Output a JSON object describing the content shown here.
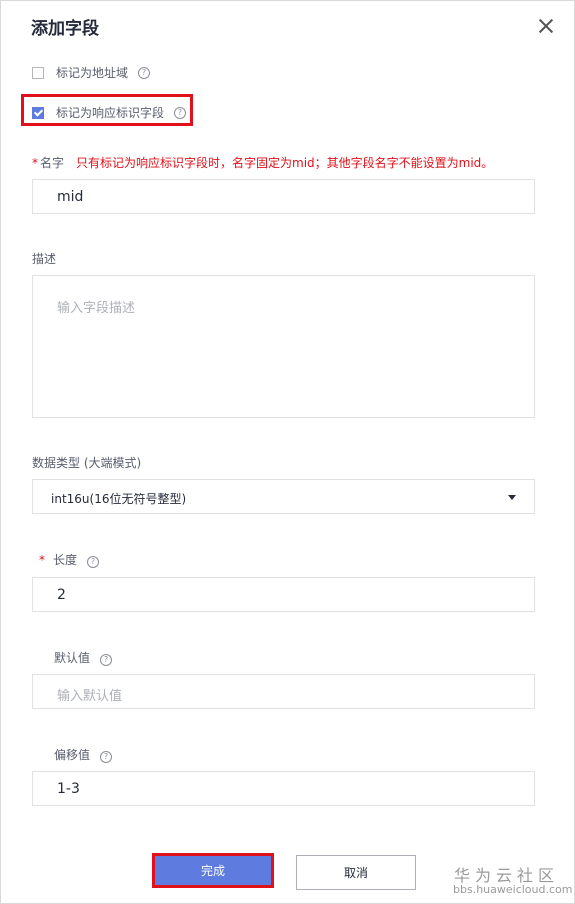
{
  "dialog": {
    "title": "添加字段",
    "checkboxes": [
      {
        "label": "标记为地址域",
        "checked": false
      },
      {
        "label": "标记为响应标识字段",
        "checked": true
      }
    ],
    "name": {
      "required_mark": "*",
      "label": "名字",
      "hint": "只有标记为响应标识字段时，名字固定为mid；其他字段名字不能设置为mid。",
      "value": "mid"
    },
    "description": {
      "label": "描述",
      "placeholder": "输入字段描述"
    },
    "data_type": {
      "label": "数据类型 (大端模式)",
      "value": "int16u(16位无符号整型)"
    },
    "length": {
      "required_mark": "*",
      "label": "长度",
      "value": "2"
    },
    "default_value": {
      "label": "默认值",
      "placeholder": "输入默认值"
    },
    "offset": {
      "label": "偏移值",
      "value": "1-3"
    },
    "buttons": {
      "ok": "完成",
      "cancel": "取消"
    }
  },
  "watermark": {
    "title": "华为云社区",
    "url": "bbs.huaweicloud.com"
  },
  "icons": {
    "close": "close-icon",
    "help": "help-icon",
    "dropdown": "chevron-down-icon"
  },
  "colors": {
    "accent": "#5e7ce0",
    "highlight": "#e0111a",
    "warning": "#e0111a"
  }
}
